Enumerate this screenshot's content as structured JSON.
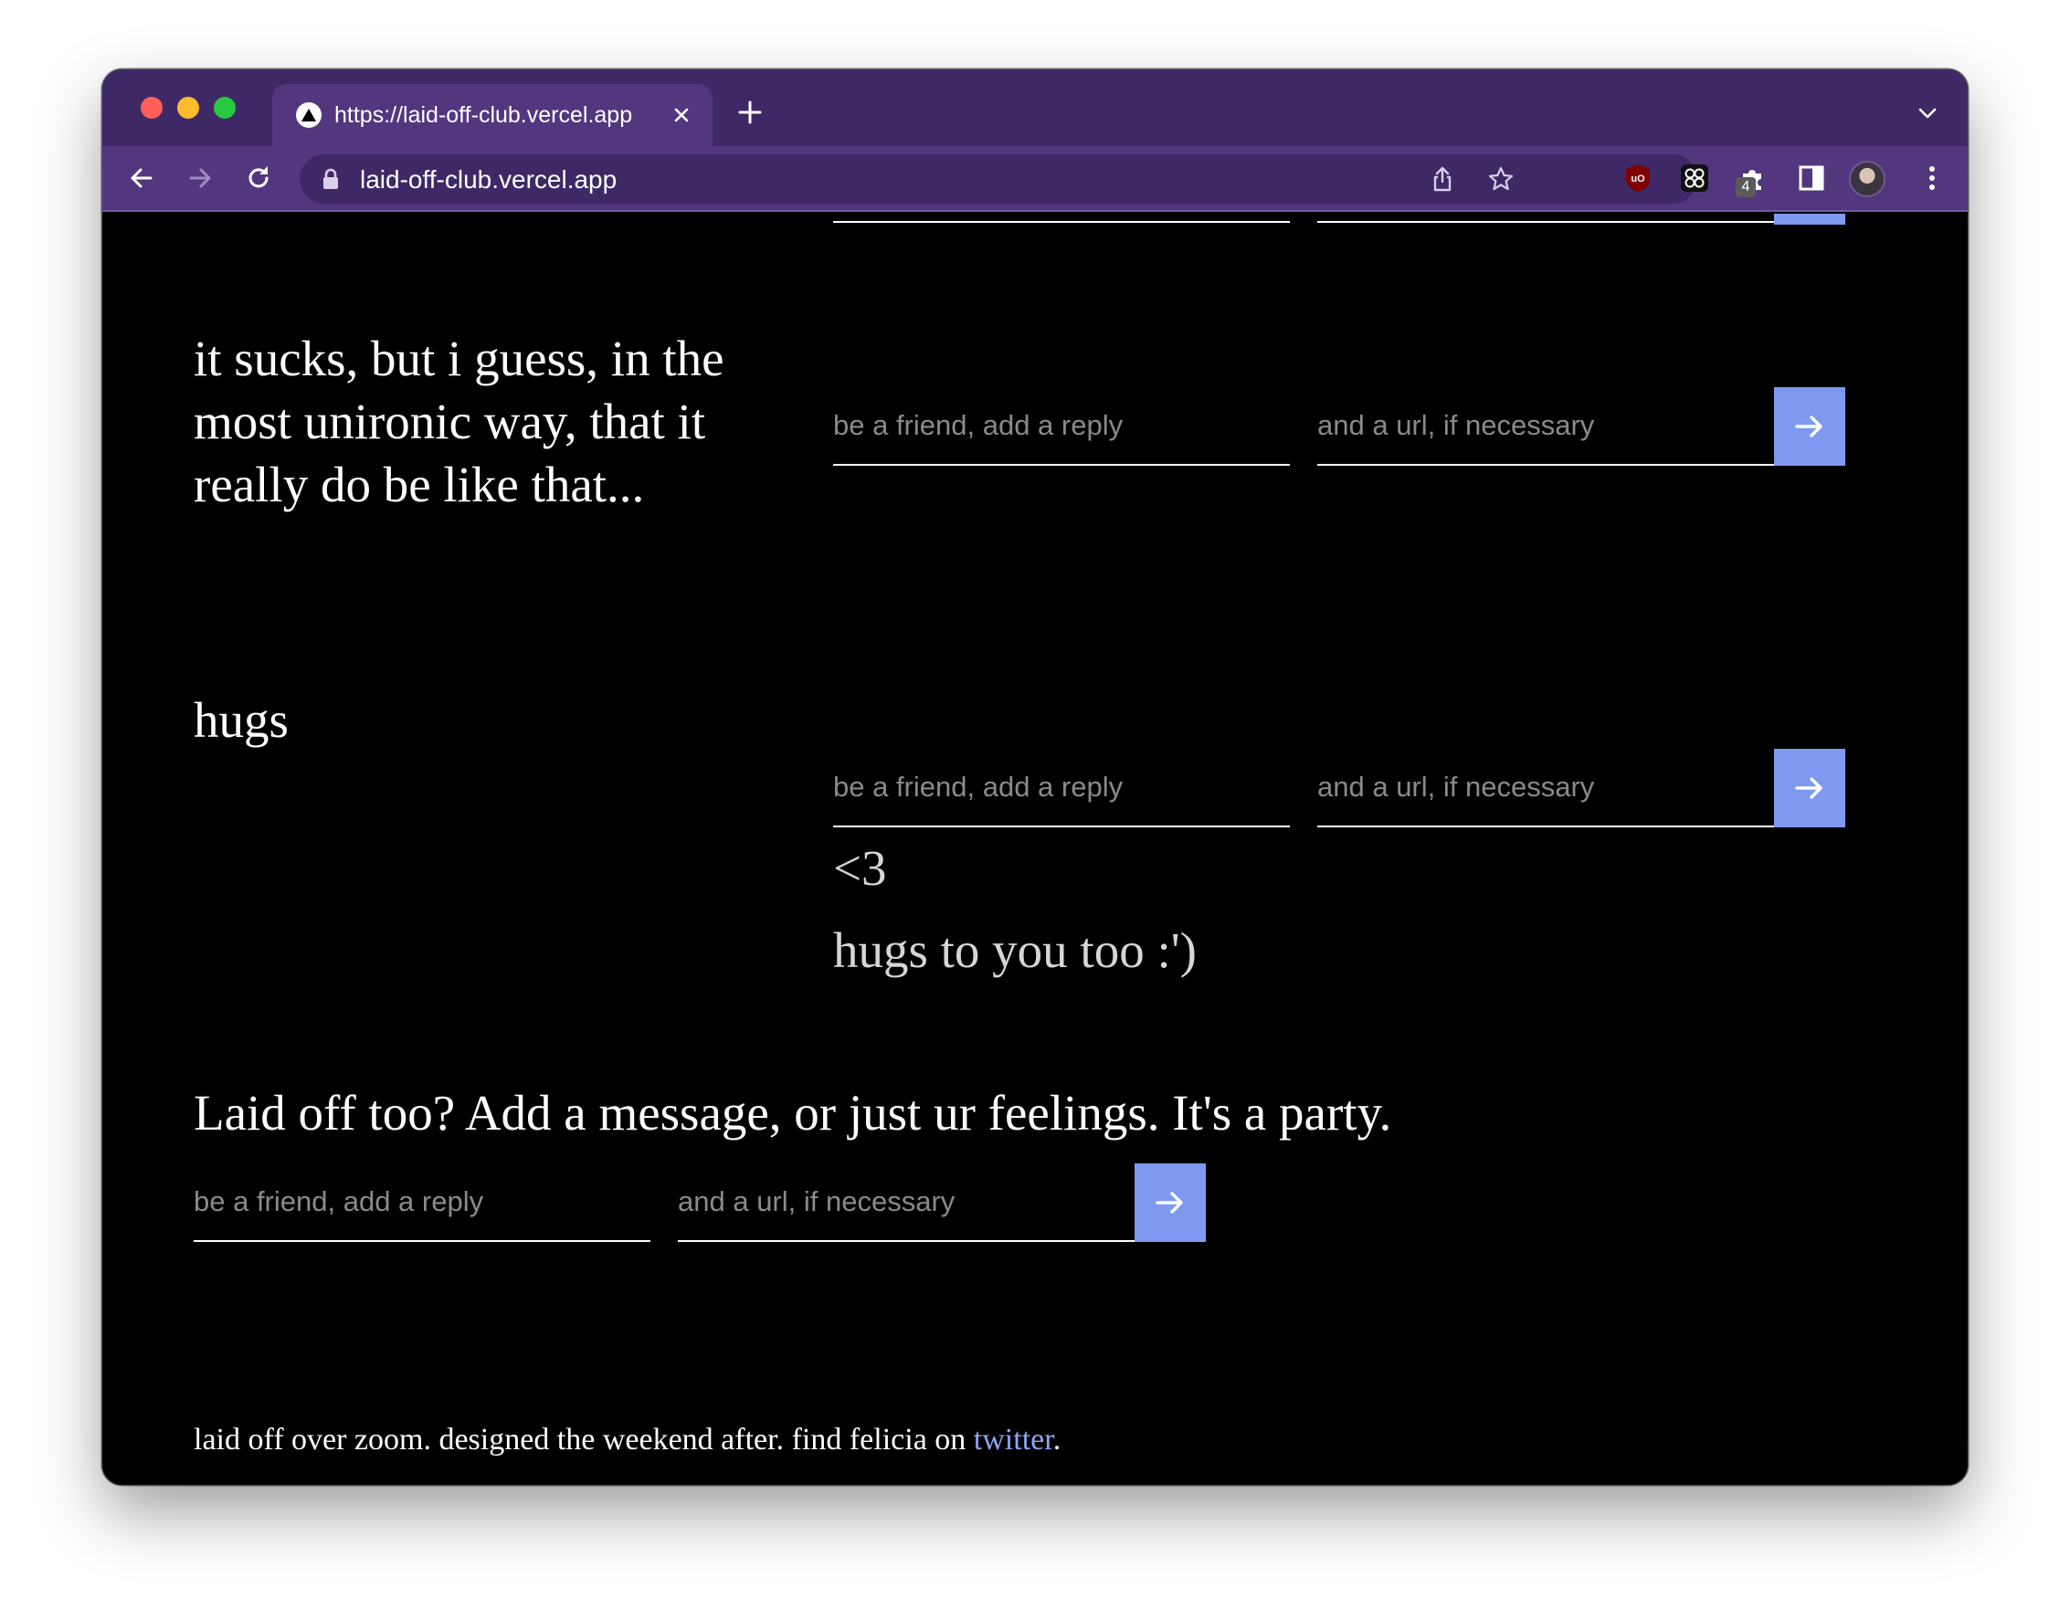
{
  "browser": {
    "tab_title": "https://laid-off-club.vercel.app",
    "url": "laid-off-club.vercel.app",
    "ublock_badge": "4"
  },
  "posts": [
    {
      "text": "it sucks, but i guess, in the most unironic way, that it really do be like that...",
      "reply_placeholder": "be a friend, add a reply",
      "url_placeholder": "and a url, if necessary",
      "replies": []
    },
    {
      "text": "hugs",
      "reply_placeholder": "be a friend, add a reply",
      "url_placeholder": "and a url, if necessary",
      "replies": [
        "<3",
        "hugs to you too :')"
      ]
    }
  ],
  "compose": {
    "heading": "Laid off too? Add a message, or just ur feelings. It's a party.",
    "reply_placeholder": "be a friend, add a reply",
    "url_placeholder": "and a url, if necessary"
  },
  "footer": {
    "text": "laid off over zoom. designed the weekend after. find felicia on",
    "link_text": "twitter",
    "suffix": "."
  },
  "colors": {
    "accent": "#7d9af0",
    "link": "#8da5f3",
    "chrome_dark": "#3e2966",
    "chrome_light": "#52377f"
  },
  "icons": [
    "traffic-lights",
    "vercel-triangle-icon",
    "close-icon",
    "plus-icon",
    "chevron-down-icon",
    "back-arrow-icon",
    "forward-arrow-icon",
    "reload-icon",
    "lock-icon",
    "share-icon",
    "star-icon",
    "ublock-icon",
    "grid-extension-icon",
    "puzzle-icon",
    "side-panel-icon",
    "kebab-menu-icon",
    "arrow-right-icon"
  ]
}
